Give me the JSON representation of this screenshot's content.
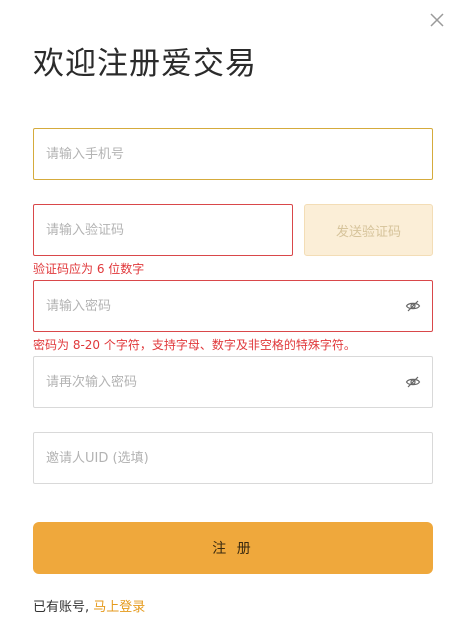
{
  "title": "欢迎注册爱交易",
  "form": {
    "phone_placeholder": "请输入手机号",
    "code_placeholder": "请输入验证码",
    "send_code_label": "发送验证码",
    "code_error": "验证码应为 6 位数字",
    "password_placeholder": "请输入密码",
    "password_error": "密码为 8-20 个字符，支持字母、数字及非空格的特殊字符。",
    "confirm_password_placeholder": "请再次输入密码",
    "invite_placeholder": "邀请人UID (选填)",
    "submit_label": "注 册"
  },
  "footer": {
    "prompt": "已有账号,",
    "login_link": "马上登录"
  },
  "icons": {
    "close": "close-icon",
    "eye_hidden": "eye-off-icon"
  },
  "colors": {
    "accent": "#efa83c",
    "error": "#e0383b",
    "focus_border": "#d5ab3c",
    "link": "#e59a1c"
  }
}
